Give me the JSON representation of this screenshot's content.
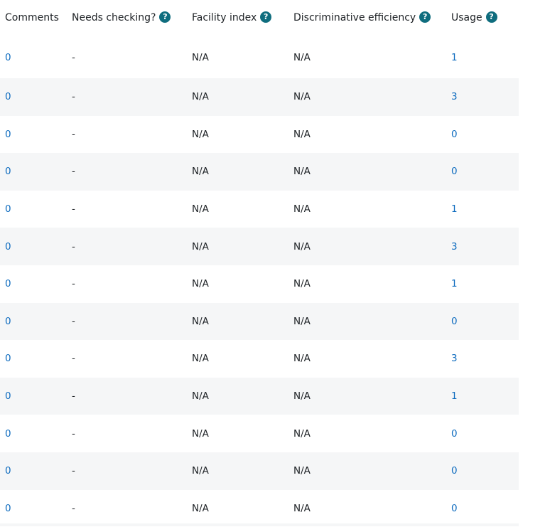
{
  "headers": {
    "comments": "Comments",
    "needs_checking": "Needs checking?",
    "facility_index": "Facility index",
    "discriminative_efficiency": "Discriminative efficiency",
    "usage": "Usage",
    "help_glyph": "?"
  },
  "colors": {
    "link": "#0f6cbf",
    "help_icon": "#0f6d7e",
    "stripe": "#f5f6f7"
  },
  "rows": [
    {
      "comments": "0",
      "needs_checking": "-",
      "facility_index": "N/A",
      "discriminative_efficiency": "N/A",
      "usage": "1"
    },
    {
      "comments": "0",
      "needs_checking": "-",
      "facility_index": "N/A",
      "discriminative_efficiency": "N/A",
      "usage": "3"
    },
    {
      "comments": "0",
      "needs_checking": "-",
      "facility_index": "N/A",
      "discriminative_efficiency": "N/A",
      "usage": "0"
    },
    {
      "comments": "0",
      "needs_checking": "-",
      "facility_index": "N/A",
      "discriminative_efficiency": "N/A",
      "usage": "0"
    },
    {
      "comments": "0",
      "needs_checking": "-",
      "facility_index": "N/A",
      "discriminative_efficiency": "N/A",
      "usage": "1"
    },
    {
      "comments": "0",
      "needs_checking": "-",
      "facility_index": "N/A",
      "discriminative_efficiency": "N/A",
      "usage": "3"
    },
    {
      "comments": "0",
      "needs_checking": "-",
      "facility_index": "N/A",
      "discriminative_efficiency": "N/A",
      "usage": "1"
    },
    {
      "comments": "0",
      "needs_checking": "-",
      "facility_index": "N/A",
      "discriminative_efficiency": "N/A",
      "usage": "0"
    },
    {
      "comments": "0",
      "needs_checking": "-",
      "facility_index": "N/A",
      "discriminative_efficiency": "N/A",
      "usage": "3"
    },
    {
      "comments": "0",
      "needs_checking": "-",
      "facility_index": "N/A",
      "discriminative_efficiency": "N/A",
      "usage": "1"
    },
    {
      "comments": "0",
      "needs_checking": "-",
      "facility_index": "N/A",
      "discriminative_efficiency": "N/A",
      "usage": "0"
    },
    {
      "comments": "0",
      "needs_checking": "-",
      "facility_index": "N/A",
      "discriminative_efficiency": "N/A",
      "usage": "0"
    },
    {
      "comments": "0",
      "needs_checking": "-",
      "facility_index": "N/A",
      "discriminative_efficiency": "N/A",
      "usage": "0"
    }
  ]
}
